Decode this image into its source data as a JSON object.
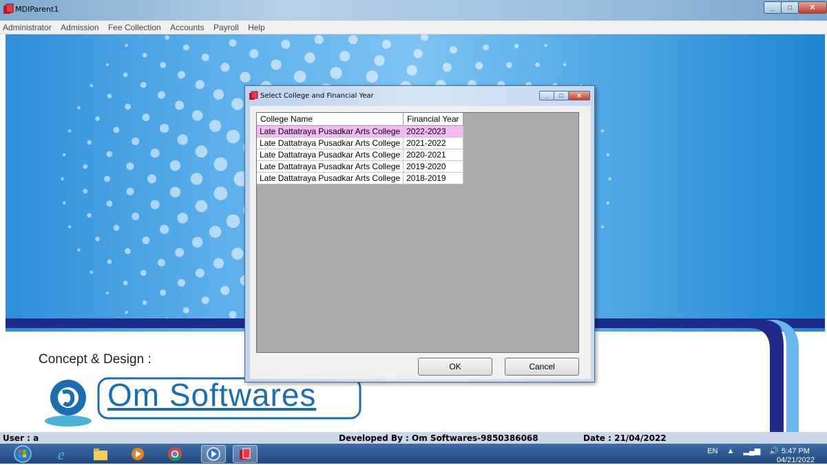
{
  "window": {
    "title": "MDIParent1"
  },
  "menu": [
    "Administrator",
    "Admission",
    "Fee Collection",
    "Accounts",
    "Payroll",
    "Help"
  ],
  "background": {
    "concept_label": "Concept & Design :",
    "brand_name": "Om Softwares"
  },
  "status": {
    "user": "User : a",
    "developer": "Developed By : Om Softwares-9850386068",
    "date": "Date : 21/04/2022"
  },
  "dialog": {
    "title": "Select College and Financial Year",
    "columns": [
      "College Name",
      "Financial Year"
    ],
    "rows": [
      {
        "college": "Late Dattatraya Pusadkar Arts College",
        "year": "2022-2023",
        "selected": true
      },
      {
        "college": "Late Dattatraya Pusadkar Arts College",
        "year": "2021-2022",
        "selected": false
      },
      {
        "college": "Late Dattatraya Pusadkar Arts College",
        "year": "2020-2021",
        "selected": false
      },
      {
        "college": "Late Dattatraya Pusadkar Arts College",
        "year": "2019-2020",
        "selected": false
      },
      {
        "college": "Late Dattatraya Pusadkar Arts College",
        "year": "2018-2019",
        "selected": false
      }
    ],
    "ok_label": "OK",
    "cancel_label": "Cancel",
    "selected_row_color": "#f8b8f8"
  },
  "taskbar": {
    "language": "EN",
    "time": "5:47 PM",
    "date": "04/21/2022"
  },
  "colors": {
    "title_bar": "#9ec0de",
    "close_button": "#c63b28",
    "sky_blue": "#5aaeea",
    "band_navy": "#1f2a8a",
    "brand_blue": "#1b6fb0"
  }
}
